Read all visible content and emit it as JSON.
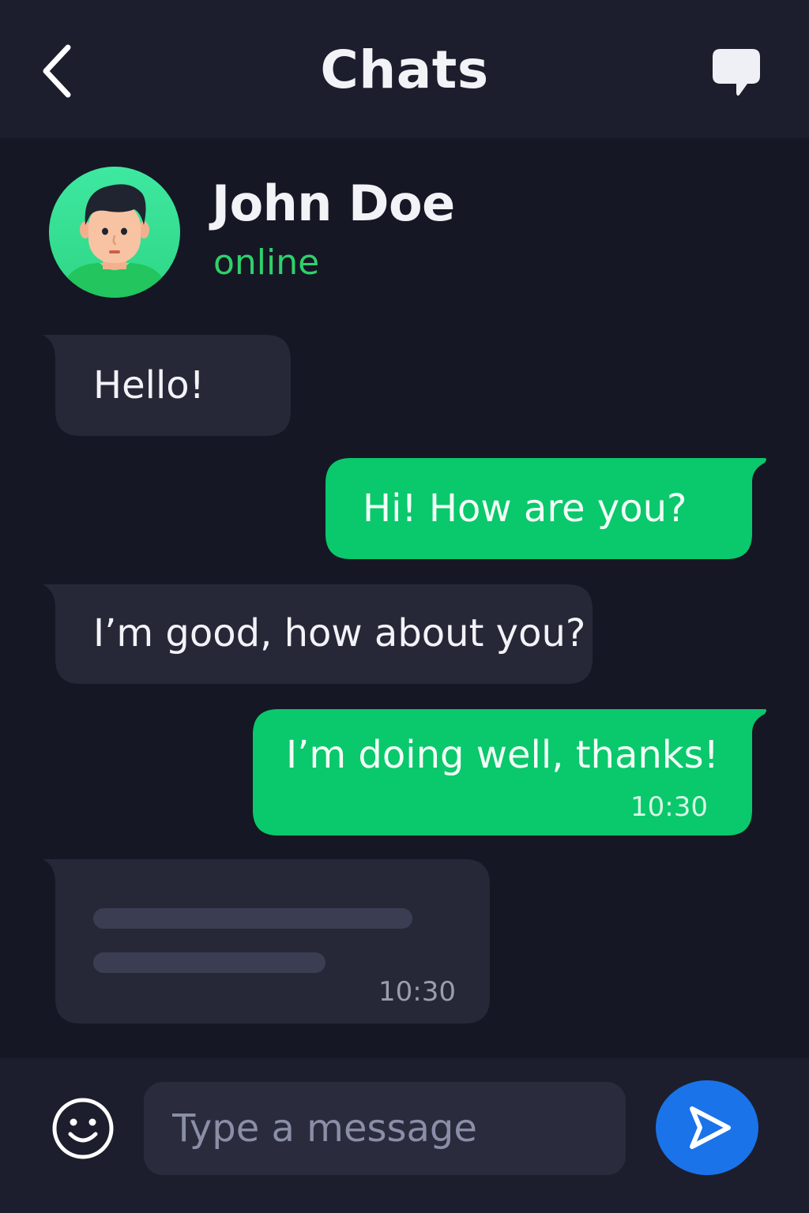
{
  "header": {
    "title": "Chats",
    "back_icon": "chevron-left-icon",
    "new_chat_icon": "chat-bubble-icon"
  },
  "contact": {
    "name": "John Doe",
    "status": "online",
    "avatar_icon": "person-avatar-icon"
  },
  "messages": [
    {
      "direction": "incoming",
      "text": "Hello!"
    },
    {
      "direction": "outgoing",
      "text": "Hi! How are you?"
    },
    {
      "direction": "incoming",
      "text": "I’m good, how about you?"
    },
    {
      "direction": "outgoing",
      "text": "I’m doing well, thanks!",
      "time": "10:30"
    },
    {
      "direction": "incoming",
      "text": "",
      "time": "10:30",
      "placeholder": true
    }
  ],
  "composer": {
    "placeholder": "Type a message",
    "emoji_icon": "smiley-icon",
    "send_icon": "send-icon"
  },
  "colors": {
    "background": "#161724",
    "header_background": "#1c1e2d",
    "incoming_bubble": "#262838",
    "outgoing_bubble": "#0ac86c",
    "status_online": "#2ed16a",
    "send_button": "#1a73e8",
    "avatar_background": "#34e08f"
  }
}
